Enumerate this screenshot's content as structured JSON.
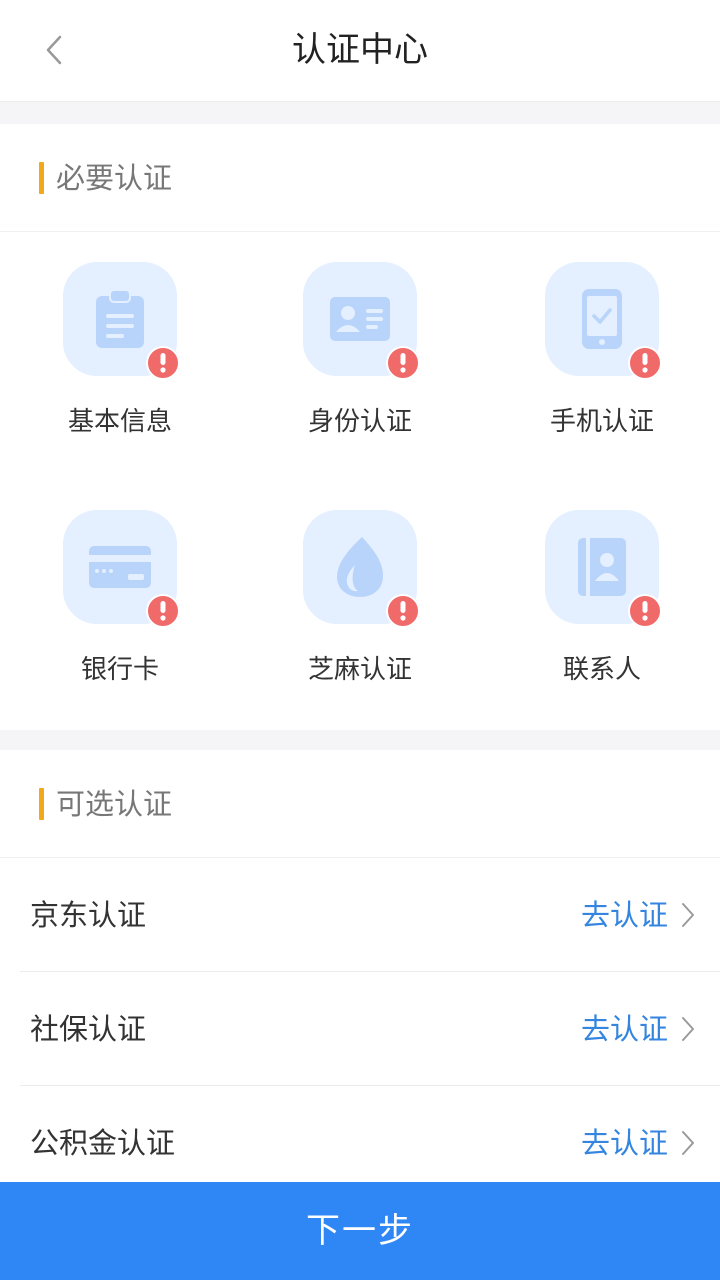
{
  "header": {
    "title": "认证中心",
    "back_icon": "chevron-left-icon"
  },
  "required_section": {
    "title": "必要认证",
    "accent_color": "#f2a81d",
    "items": [
      {
        "label": "基本信息",
        "icon": "clipboard-icon",
        "status": "alert"
      },
      {
        "label": "身份认证",
        "icon": "id-card-icon",
        "status": "alert"
      },
      {
        "label": "手机认证",
        "icon": "phone-check-icon",
        "status": "alert"
      },
      {
        "label": "银行卡",
        "icon": "bank-card-icon",
        "status": "alert"
      },
      {
        "label": "芝麻认证",
        "icon": "sesame-drop-icon",
        "status": "alert"
      },
      {
        "label": "联系人",
        "icon": "contact-book-icon",
        "status": "alert"
      }
    ]
  },
  "optional_section": {
    "title": "可选认证",
    "items": [
      {
        "label": "京东认证",
        "action": "去认证"
      },
      {
        "label": "社保认证",
        "action": "去认证"
      },
      {
        "label": "公积金认证",
        "action": "去认证"
      }
    ]
  },
  "footer": {
    "next_label": "下一步",
    "button_color": "#2f86f5"
  },
  "colors": {
    "icon_tile_bg": "#e4efff",
    "icon_fg": "#b9d4fb",
    "alert": "#f16a6a",
    "link": "#3485e0"
  }
}
